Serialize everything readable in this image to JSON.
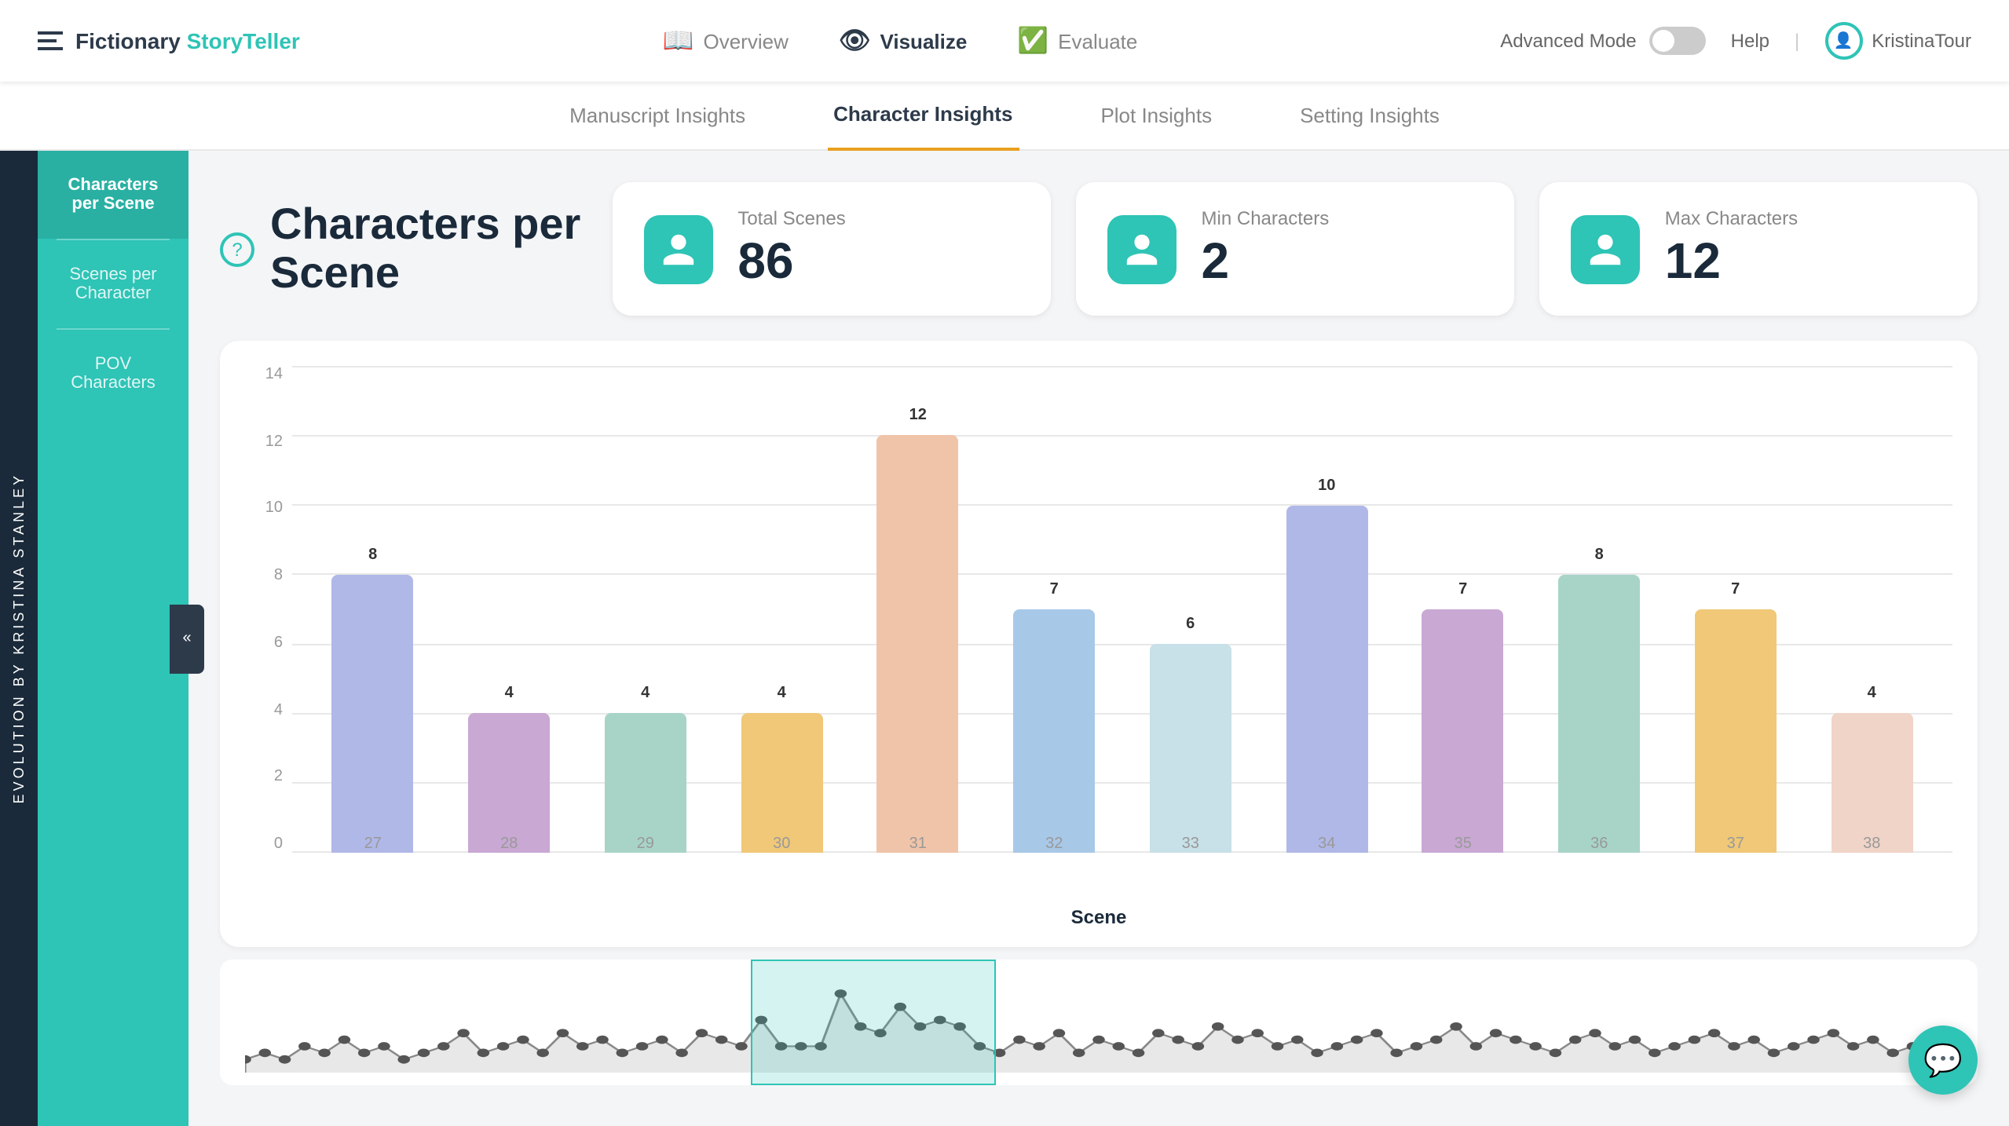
{
  "app": {
    "logo_fictionary": "Fictionary",
    "logo_storyteller": "StoryTeller"
  },
  "nav": {
    "tabs": [
      {
        "id": "overview",
        "label": "Overview",
        "icon": "📖",
        "active": false
      },
      {
        "id": "visualize",
        "label": "Visualize",
        "icon": "👁",
        "active": true
      },
      {
        "id": "evaluate",
        "label": "Evaluate",
        "icon": "✅",
        "active": false
      }
    ],
    "advanced_mode": "Advanced Mode",
    "help": "Help",
    "user": "KristinaTour"
  },
  "sub_nav": {
    "items": [
      {
        "id": "manuscript",
        "label": "Manuscript Insights",
        "active": false
      },
      {
        "id": "character",
        "label": "Character Insights",
        "active": true
      },
      {
        "id": "plot",
        "label": "Plot Insights",
        "active": false
      },
      {
        "id": "setting",
        "label": "Setting Insights",
        "active": false
      }
    ]
  },
  "sidebar_rotated": "EVOLUTION BY KRISTINA STANLEY",
  "sidebar": {
    "items": [
      {
        "id": "characters-per-scene",
        "label": "Characters per Scene",
        "active": true
      },
      {
        "id": "scenes-per-character",
        "label": "Scenes per Character",
        "active": false
      },
      {
        "id": "pov-characters",
        "label": "POV Characters",
        "active": false
      }
    ]
  },
  "section": {
    "title_line1": "Characters per",
    "title_line2": "Scene",
    "question_mark": "?"
  },
  "stats": [
    {
      "id": "total-scenes",
      "label": "Total Scenes",
      "value": "86"
    },
    {
      "id": "min-characters",
      "label": "Min Characters",
      "value": "2"
    },
    {
      "id": "max-characters",
      "label": "Max Characters",
      "value": "12"
    }
  ],
  "chart": {
    "y_labels": [
      "14",
      "12",
      "10",
      "8",
      "6",
      "4",
      "2",
      "0"
    ],
    "x_axis_title": "Scene",
    "bars": [
      {
        "scene": "27",
        "value": 8,
        "color": "#b0b8e8"
      },
      {
        "scene": "28",
        "value": 4,
        "color": "#c9a8d4"
      },
      {
        "scene": "29",
        "value": 4,
        "color": "#a8d4c8"
      },
      {
        "scene": "30",
        "value": 4,
        "color": "#f0c878"
      },
      {
        "scene": "31",
        "value": 12,
        "color": "#f0c4a8"
      },
      {
        "scene": "32",
        "value": 7,
        "color": "#a8c8e8"
      },
      {
        "scene": "33",
        "value": 6,
        "color": "#c8e0e8"
      },
      {
        "scene": "34",
        "value": 10,
        "color": "#b0b8e8"
      },
      {
        "scene": "35",
        "value": 7,
        "color": "#c9a8d4"
      },
      {
        "scene": "36",
        "value": 8,
        "color": "#a8d4c8"
      },
      {
        "scene": "37",
        "value": 7,
        "color": "#f0c878"
      },
      {
        "scene": "38",
        "value": 4,
        "color": "#f0d4c8"
      }
    ],
    "max_value": 14
  },
  "collapse_icon": "«"
}
